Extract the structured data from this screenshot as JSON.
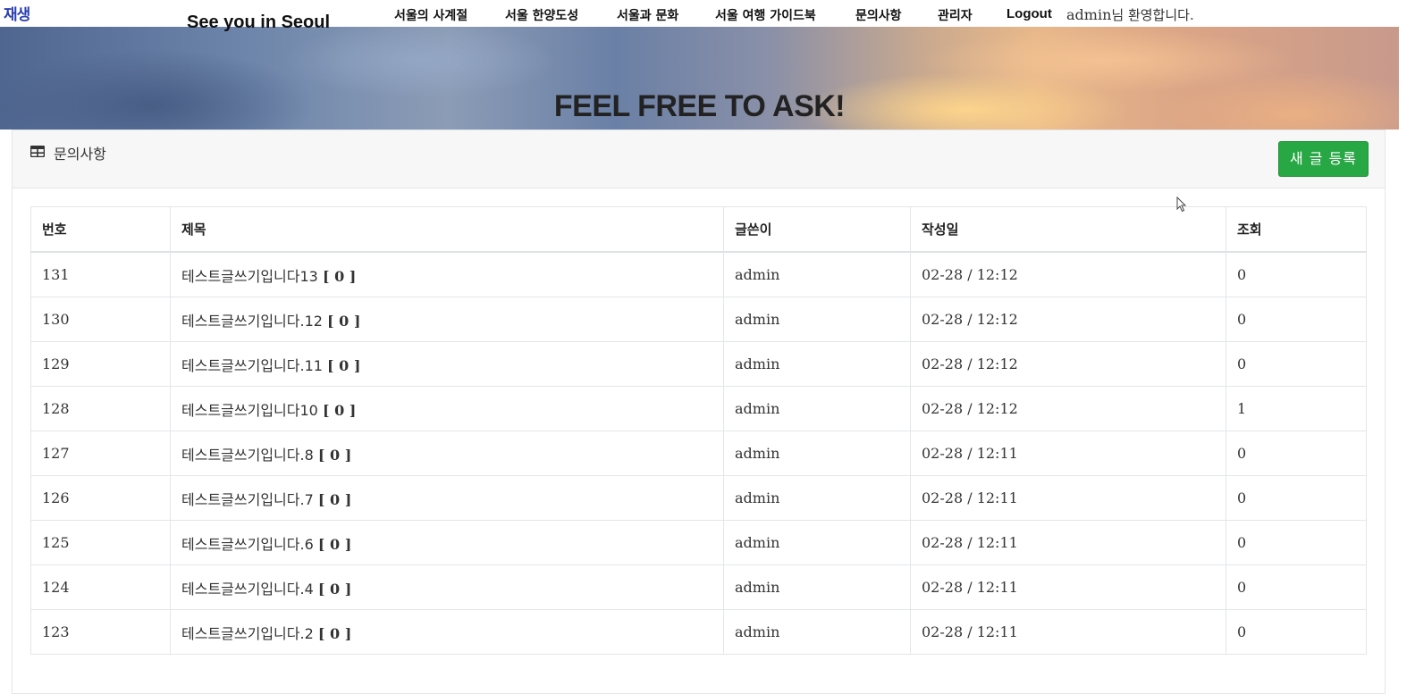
{
  "replay_badge": "재생",
  "nav": {
    "brand": "See you in Seoul",
    "items": [
      "서울의 사계절",
      "서울 한양도성",
      "서울과 문화",
      "서울 여행 가이드북",
      "문의사항",
      "관리자"
    ],
    "logout": "Logout",
    "welcome_user": "admin",
    "welcome_suffix": "님 환영합니다."
  },
  "hero": {
    "title": "FEEL FREE TO ASK!"
  },
  "board": {
    "header_icon": "table-icon",
    "title": "문의사항",
    "new_post_label": "새 글 등록",
    "accent_color": "#28a745",
    "columns": [
      "번호",
      "제목",
      "글쓴이",
      "작성일",
      "조회"
    ],
    "rows": [
      {
        "no": "131",
        "title": "테스트글쓰기입니다13",
        "replies": "[ 0 ]",
        "author": "admin",
        "date": "02-28 / 12:12",
        "views": "0"
      },
      {
        "no": "130",
        "title": "테스트글쓰기입니다.12",
        "replies": "[ 0 ]",
        "author": "admin",
        "date": "02-28 / 12:12",
        "views": "0"
      },
      {
        "no": "129",
        "title": "테스트글쓰기입니다.11",
        "replies": "[ 0 ]",
        "author": "admin",
        "date": "02-28 / 12:12",
        "views": "0"
      },
      {
        "no": "128",
        "title": "테스트글쓰기입니다10",
        "replies": "[ 0 ]",
        "author": "admin",
        "date": "02-28 / 12:12",
        "views": "1"
      },
      {
        "no": "127",
        "title": "테스트글쓰기입니다.8",
        "replies": "[ 0 ]",
        "author": "admin",
        "date": "02-28 / 12:11",
        "views": "0"
      },
      {
        "no": "126",
        "title": "테스트글쓰기입니다.7",
        "replies": "[ 0 ]",
        "author": "admin",
        "date": "02-28 / 12:11",
        "views": "0"
      },
      {
        "no": "125",
        "title": "테스트글쓰기입니다.6",
        "replies": "[ 0 ]",
        "author": "admin",
        "date": "02-28 / 12:11",
        "views": "0"
      },
      {
        "no": "124",
        "title": "테스트글쓰기입니다.4",
        "replies": "[ 0 ]",
        "author": "admin",
        "date": "02-28 / 12:11",
        "views": "0"
      },
      {
        "no": "123",
        "title": "테스트글쓰기입니다.2",
        "replies": "[ 0 ]",
        "author": "admin",
        "date": "02-28 / 12:11",
        "views": "0"
      }
    ]
  }
}
